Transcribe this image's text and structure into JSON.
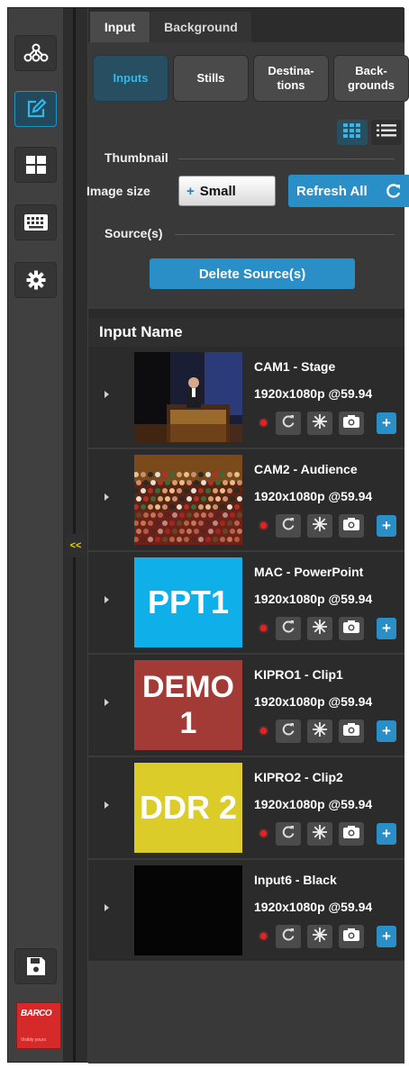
{
  "toolbar": {
    "items": [
      {
        "icon": "network-icon",
        "active": false
      },
      {
        "icon": "edit-icon",
        "active": true
      },
      {
        "icon": "layout-grid-icon",
        "active": false
      },
      {
        "icon": "keyboard-icon",
        "active": false
      },
      {
        "icon": "gear-icon",
        "active": false
      }
    ],
    "save_icon": "save-icon",
    "logo_text": "BARCO",
    "logo_tagline": "Visibly yours",
    "collapse_label": "<<"
  },
  "tabs": [
    {
      "label": "Input",
      "active": true
    },
    {
      "label": "Background",
      "active": false
    }
  ],
  "categories": [
    {
      "label": "Inputs",
      "active": true
    },
    {
      "label": "Stills",
      "active": false
    },
    {
      "label": "Destina-\ntions",
      "active": false
    },
    {
      "label": "Back-\ngrounds",
      "active": false
    }
  ],
  "view_mode": "grid",
  "thumbnail": {
    "section_label": "Thumbnail",
    "image_size_label": "Image size",
    "size_value": "Small",
    "refresh_label": "Refresh All"
  },
  "sources": {
    "section_label": "Source(s)",
    "delete_label": "Delete Source(s)"
  },
  "list": {
    "header": "Input Name",
    "rows": [
      {
        "name": "CAM1 - Stage",
        "format": "1920x1080p @59.94",
        "thumb": {
          "kind": "photo-stage",
          "text": ""
        }
      },
      {
        "name": "CAM2 - Audience",
        "format": "1920x1080p @59.94",
        "thumb": {
          "kind": "photo-audience",
          "text": ""
        }
      },
      {
        "name": "MAC - PowerPoint",
        "format": "1920x1080p @59.94",
        "thumb": {
          "kind": "label",
          "text": "PPT1",
          "bg": "#0fb0ea",
          "fg": "#ffffff"
        }
      },
      {
        "name": "KIPRO1 - Clip1",
        "format": "1920x1080p @59.94",
        "thumb": {
          "kind": "label",
          "text": "DEMO\n1",
          "bg": "#a23a36",
          "fg": "#ffffff"
        }
      },
      {
        "name": "KIPRO2 - Clip2",
        "format": "1920x1080p @59.94",
        "thumb": {
          "kind": "label",
          "text": "DDR 2",
          "bg": "#dccc2a",
          "fg": "#ffffff"
        }
      },
      {
        "name": "Input6 - Black",
        "format": "1920x1080p @59.94",
        "thumb": {
          "kind": "black",
          "text": ""
        }
      }
    ]
  },
  "colors": {
    "accent": "#2a8ec7",
    "active_segment_text": "#35b7ea",
    "led_red": "#e8201e"
  }
}
